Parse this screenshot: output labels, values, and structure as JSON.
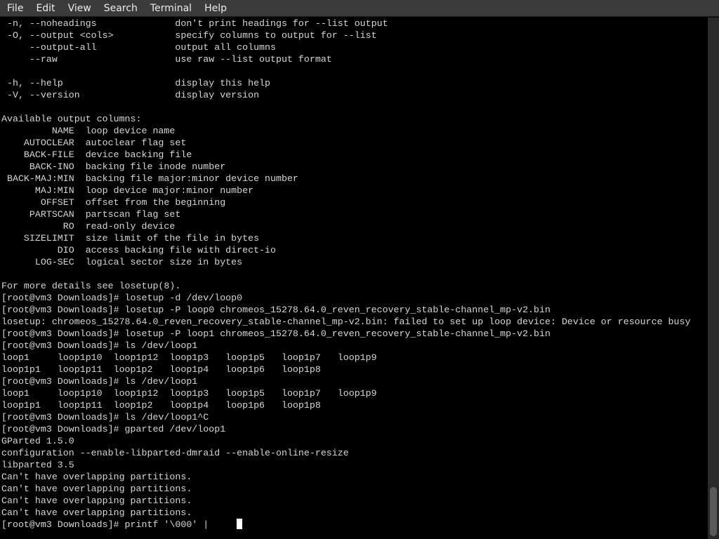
{
  "menu": {
    "file": "File",
    "edit": "Edit",
    "view": "View",
    "search": "Search",
    "terminal": "Terminal",
    "help": "Help"
  },
  "terminal": {
    "lines": [
      " -n, --noheadings              don't print headings for --list output",
      " -O, --output <cols>           specify columns to output for --list",
      "     --output-all              output all columns",
      "     --raw                     use raw --list output format",
      "",
      " -h, --help                    display this help",
      " -V, --version                 display version",
      "",
      "Available output columns:",
      "         NAME  loop device name",
      "    AUTOCLEAR  autoclear flag set",
      "    BACK-FILE  device backing file",
      "     BACK-INO  backing file inode number",
      " BACK-MAJ:MIN  backing file major:minor device number",
      "      MAJ:MIN  loop device major:minor number",
      "       OFFSET  offset from the beginning",
      "     PARTSCAN  partscan flag set",
      "           RO  read-only device",
      "    SIZELIMIT  size limit of the file in bytes",
      "          DIO  access backing file with direct-io",
      "      LOG-SEC  logical sector size in bytes",
      "",
      "For more details see losetup(8).",
      "[root@vm3 Downloads]# losetup -d /dev/loop0",
      "[root@vm3 Downloads]# losetup -P loop0 chromeos_15278.64.0_reven_recovery_stable-channel_mp-v2.bin",
      "losetup: chromeos_15278.64.0_reven_recovery_stable-channel_mp-v2.bin: failed to set up loop device: Device or resource busy",
      "[root@vm3 Downloads]# losetup -P loop1 chromeos_15278.64.0_reven_recovery_stable-channel_mp-v2.bin",
      "[root@vm3 Downloads]# ls /dev/loop1",
      "loop1     loop1p10  loop1p12  loop1p3   loop1p5   loop1p7   loop1p9",
      "loop1p1   loop1p11  loop1p2   loop1p4   loop1p6   loop1p8",
      "[root@vm3 Downloads]# ls /dev/loop1",
      "loop1     loop1p10  loop1p12  loop1p3   loop1p5   loop1p7   loop1p9",
      "loop1p1   loop1p11  loop1p2   loop1p4   loop1p6   loop1p8",
      "[root@vm3 Downloads]# ls /dev/loop1^C",
      "[root@vm3 Downloads]# gparted /dev/loop1",
      "GParted 1.5.0",
      "configuration --enable-libparted-dmraid --enable-online-resize",
      "libparted 3.5",
      "Can't have overlapping partitions.",
      "Can't have overlapping partitions.",
      "Can't have overlapping partitions.",
      "Can't have overlapping partitions."
    ],
    "prompt": "[root@vm3 Downloads]# printf '\\000' |     "
  }
}
